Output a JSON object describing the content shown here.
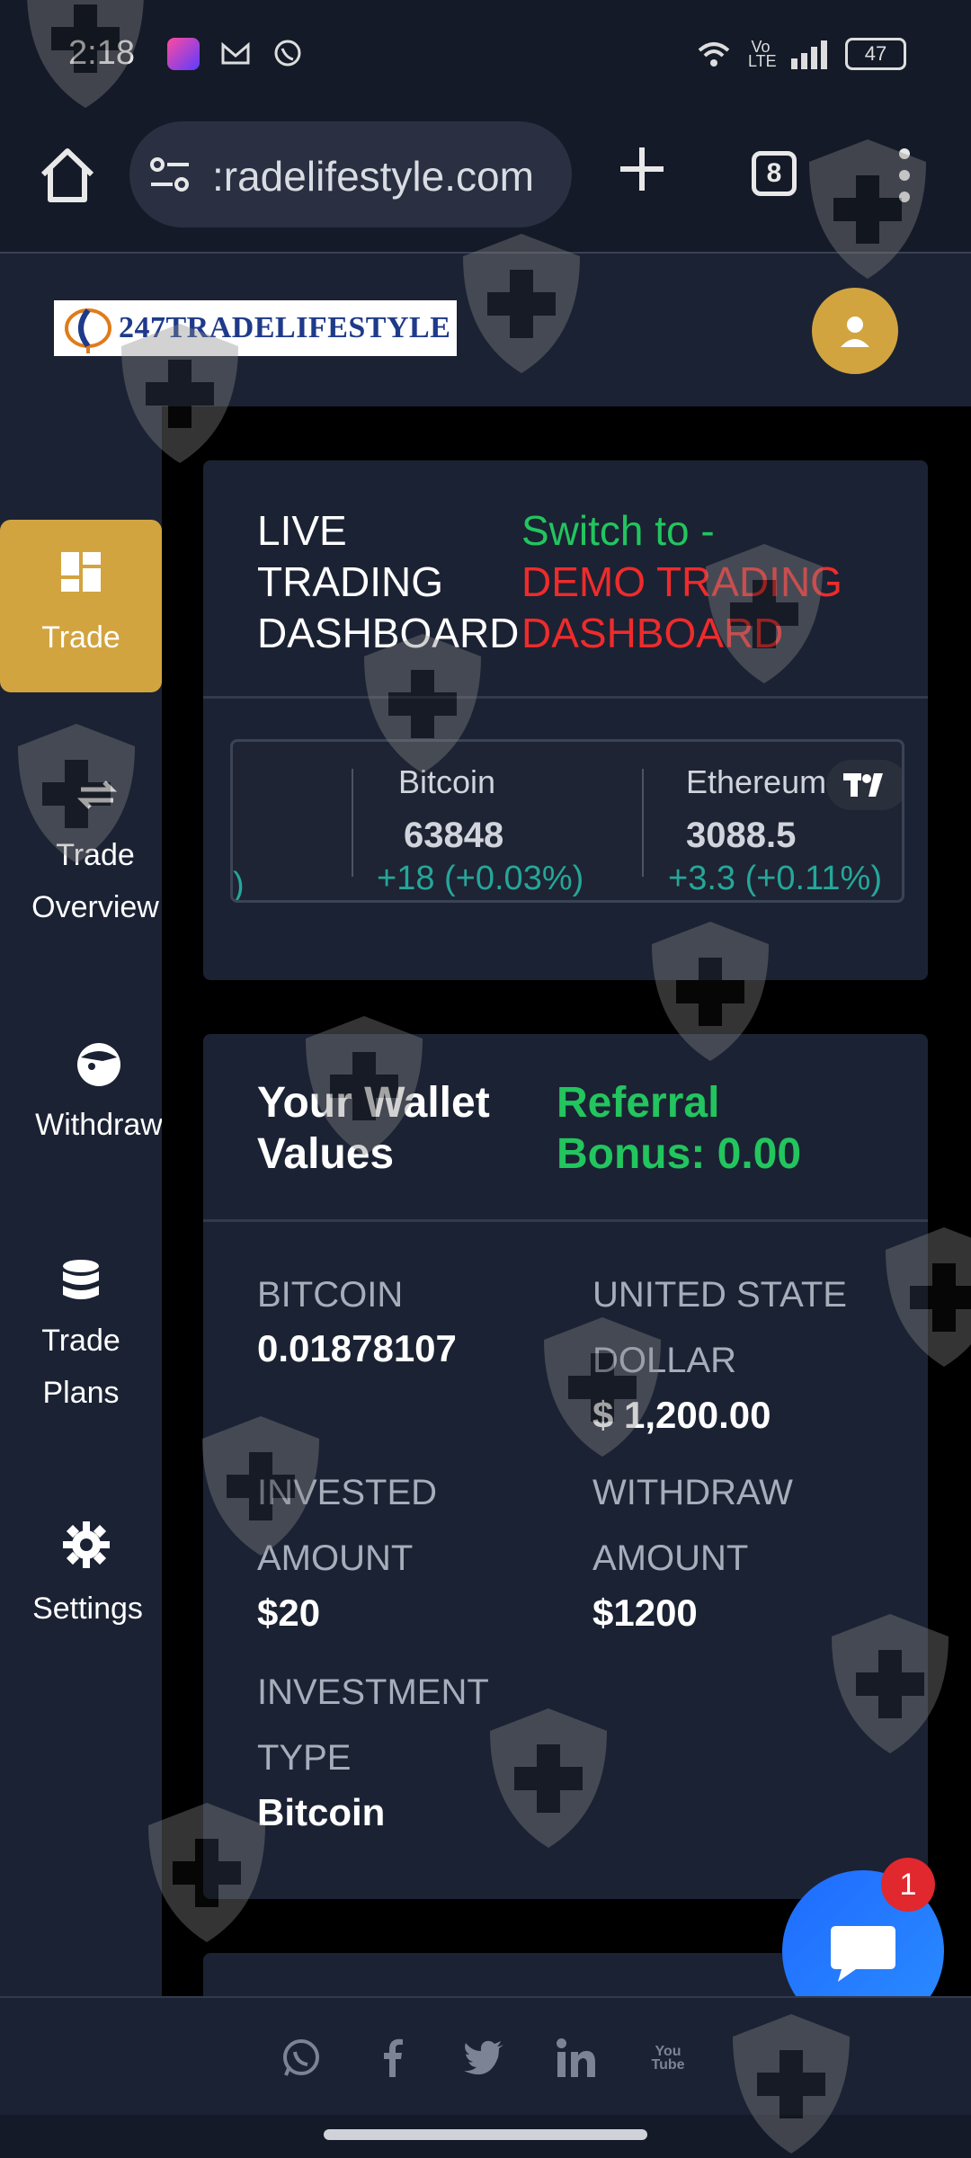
{
  "status_bar": {
    "time": "2:18",
    "battery": "47",
    "network": "Vo LTE"
  },
  "browser": {
    "url": ":radelifestyle.com",
    "tab_count": "8"
  },
  "header": {
    "logo_text": "247TRADELIFESTYLE"
  },
  "sidebar": {
    "items": [
      {
        "label": "Trade",
        "icon": "dashboard-icon",
        "active": true
      },
      {
        "label": "Trade Overview",
        "icon": "swap-icon",
        "active": false
      },
      {
        "label": "Withdraw",
        "icon": "withdraw-face-icon",
        "active": false
      },
      {
        "label": "Trade Plans",
        "icon": "database-icon",
        "active": false
      },
      {
        "label": "Settings",
        "icon": "gear-icon",
        "active": false
      }
    ]
  },
  "dashboard": {
    "title": "LIVE TRADING DASHBOARD",
    "switch_prefix": "Switch to -",
    "switch_target": "DEMO TRADING DASHBOARD"
  },
  "ticker": {
    "items": [
      {
        "name": "Bitcoin",
        "price": "63848",
        "change": "+18 (+0.03%)"
      },
      {
        "name": "Ethereum",
        "price": "3088.5",
        "change": "+3.3 (+0.11%)"
      }
    ],
    "partial_left": ")"
  },
  "wallet": {
    "title": "Your Wallet Values",
    "referral": "Referral Bonus: 0.00",
    "bitcoin_label": "BITCOIN",
    "bitcoin_value": "0.01878107",
    "usd_label": "UNITED STATE DOLLAR",
    "usd_value": "$ 1,200.00",
    "invested_label": "INVESTED AMOUNT",
    "invested_value": "$20",
    "withdraw_label": "WITHDRAW AMOUNT",
    "withdraw_value": "$1200",
    "type_label": "INVESTMENT TYPE",
    "type_value": "Bitcoin"
  },
  "chat": {
    "badge": "1"
  },
  "footer": {
    "icons": [
      "whatsapp-icon",
      "facebook-icon",
      "twitter-icon",
      "linkedin-icon",
      "youtube-icon"
    ],
    "youtube_text": "You Tube"
  },
  "colors": {
    "background": "#141a28",
    "card": "#1b2233",
    "accent_gold": "#d2a440",
    "green": "#22c55e",
    "red": "#ef2b2b",
    "ticker_up": "#26a69a"
  }
}
